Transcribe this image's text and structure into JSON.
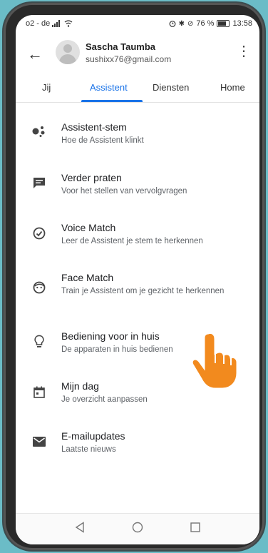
{
  "status": {
    "carrier": "o2 - de",
    "battery": "76 %",
    "time": "13:58"
  },
  "header": {
    "back_icon": "arrow-back-icon",
    "name": "Sascha Taumba",
    "email": "sushixx76@gmail.com",
    "more_icon": "more-vert-icon"
  },
  "tabs": [
    {
      "label": "Jij",
      "active": false
    },
    {
      "label": "Assistent",
      "active": true
    },
    {
      "label": "Diensten",
      "active": false
    },
    {
      "label": "Home",
      "active": false
    }
  ],
  "items": [
    {
      "title": "Assistent-stem",
      "sub": "Hoe de Assistent klinkt",
      "icon": "assistant-dots-icon"
    },
    {
      "title": "Verder praten",
      "sub": "Voor het stellen van vervolgvragen",
      "icon": "chat-bubble-icon"
    },
    {
      "title": "Voice Match",
      "sub": "Leer de Assistent je stem te herkennen",
      "icon": "check-circle-icon"
    },
    {
      "title": "Face Match",
      "sub": "Train je Assistent om je gezicht te herkennen",
      "icon": "face-icon"
    },
    {
      "title": "Bediening voor in huis",
      "sub": "De apparaten in huis bedienen",
      "icon": "lightbulb-icon"
    },
    {
      "title": "Mijn dag",
      "sub": "Je overzicht aanpassen",
      "icon": "calendar-icon"
    },
    {
      "title": "E-mailupdates",
      "sub": "Laatste nieuws",
      "icon": "mail-icon"
    }
  ],
  "navbar": [
    "back-triangle-icon",
    "home-circle-icon",
    "recents-square-icon"
  ]
}
